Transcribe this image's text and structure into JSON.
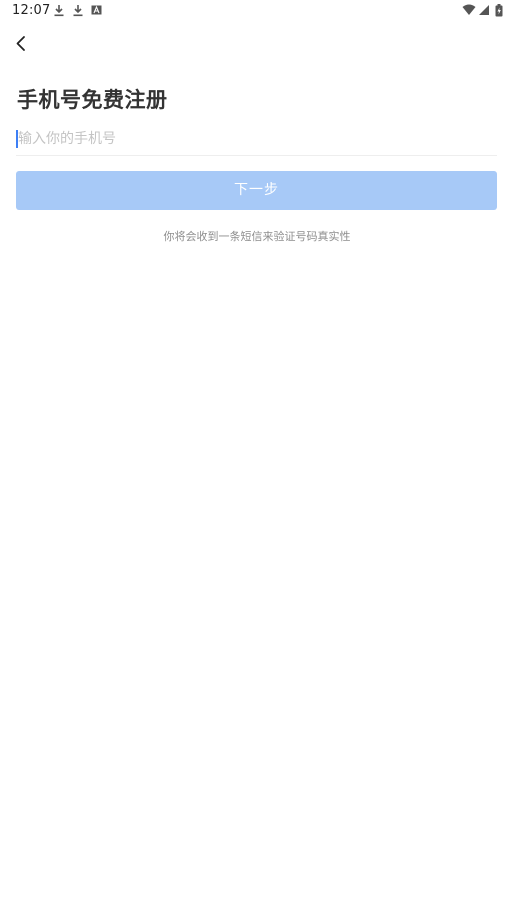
{
  "status_bar": {
    "time": "12:07",
    "left_icons": [
      "download-icon",
      "download-icon",
      "a-icon"
    ],
    "right_icons": [
      "wifi-icon",
      "signal-icon",
      "battery-icon"
    ]
  },
  "nav": {
    "back_icon": "chevron-left-icon"
  },
  "page": {
    "title": "手机号免费注册"
  },
  "phone_input": {
    "placeholder": "输入你的手机号",
    "value": ""
  },
  "next_button": {
    "label": "下一步",
    "color": "#a7c9f7"
  },
  "hint": {
    "text": "你将会收到一条短信来验证号码真实性"
  },
  "colors": {
    "accent": "#3d7ff5",
    "button_disabled": "#a7c9f7"
  }
}
